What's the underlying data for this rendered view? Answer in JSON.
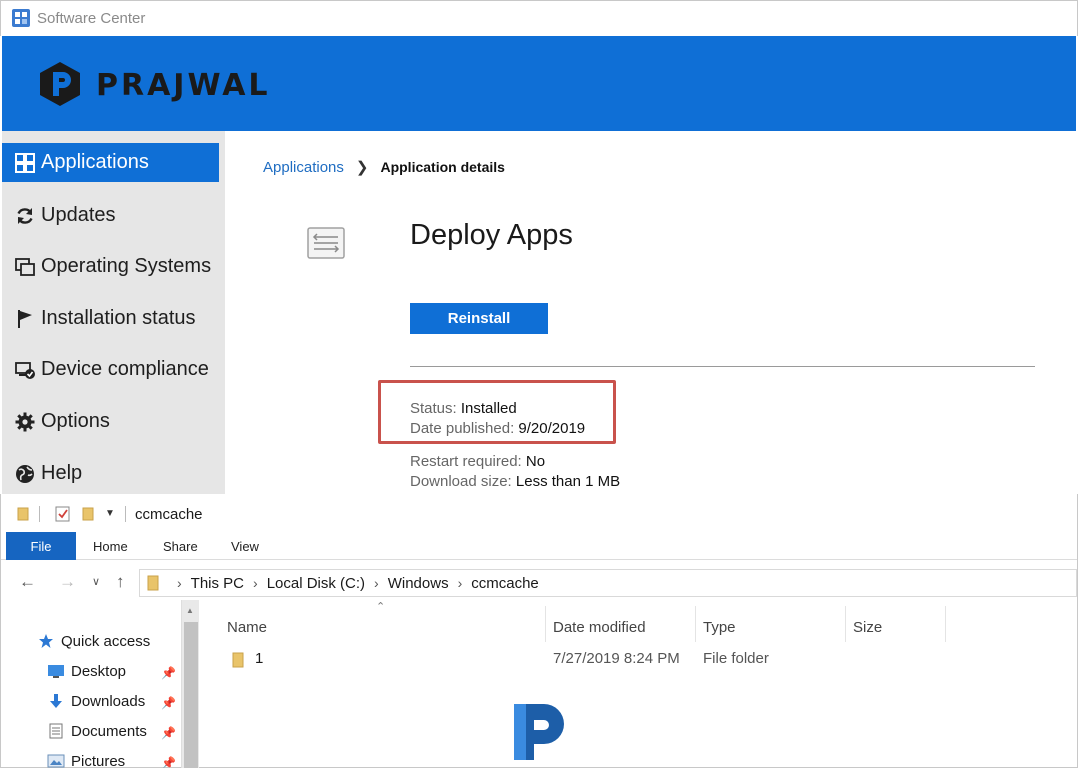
{
  "software_center": {
    "window_title": "Software Center",
    "brand": "PRAJWAL",
    "nav": [
      {
        "label": "Applications",
        "icon": "grid-icon",
        "active": true
      },
      {
        "label": "Updates",
        "icon": "refresh-icon"
      },
      {
        "label": "Operating Systems",
        "icon": "windows-stack-icon"
      },
      {
        "label": "Installation status",
        "icon": "flag-icon"
      },
      {
        "label": "Device compliance",
        "icon": "device-check-icon"
      },
      {
        "label": "Options",
        "icon": "gear-icon"
      },
      {
        "label": "Help",
        "icon": "globe-icon"
      }
    ],
    "breadcrumb": {
      "parent": "Applications",
      "current": "Application details"
    },
    "app": {
      "title": "Deploy Apps",
      "action_label": "Reinstall",
      "status_label": "Status:",
      "status_value": "Installed",
      "date_label": "Date published:",
      "date_value": "9/20/2019",
      "restart_label": "Restart required:",
      "restart_value": "No",
      "size_label": "Download size:",
      "size_value": "Less than 1 MB"
    },
    "colors": {
      "accent": "#0f6fd6",
      "sidebar": "#e6e6e6",
      "highlight": "#c9524c",
      "link": "#1f6dc2"
    }
  },
  "explorer": {
    "window_title": "ccmcache",
    "ribbon_tabs": [
      "File",
      "Home",
      "Share",
      "View"
    ],
    "address": [
      "This PC",
      "Local Disk (C:)",
      "Windows",
      "ccmcache"
    ],
    "nav_pane": [
      {
        "label": "Quick access",
        "icon": "star-icon"
      },
      {
        "label": "Desktop",
        "icon": "desktop-icon",
        "pinned": true
      },
      {
        "label": "Downloads",
        "icon": "download-arrow-icon",
        "pinned": true
      },
      {
        "label": "Documents",
        "icon": "document-icon",
        "pinned": true
      },
      {
        "label": "Pictures",
        "icon": "pictures-icon",
        "pinned": true
      }
    ],
    "columns": [
      "Name",
      "Date modified",
      "Type",
      "Size"
    ],
    "rows": [
      {
        "name": "1",
        "date_modified": "7/27/2019 8:24 PM",
        "type": "File folder",
        "size": ""
      }
    ],
    "colors": {
      "file_tab": "#1665c1",
      "folder": "#e9c46a"
    }
  }
}
